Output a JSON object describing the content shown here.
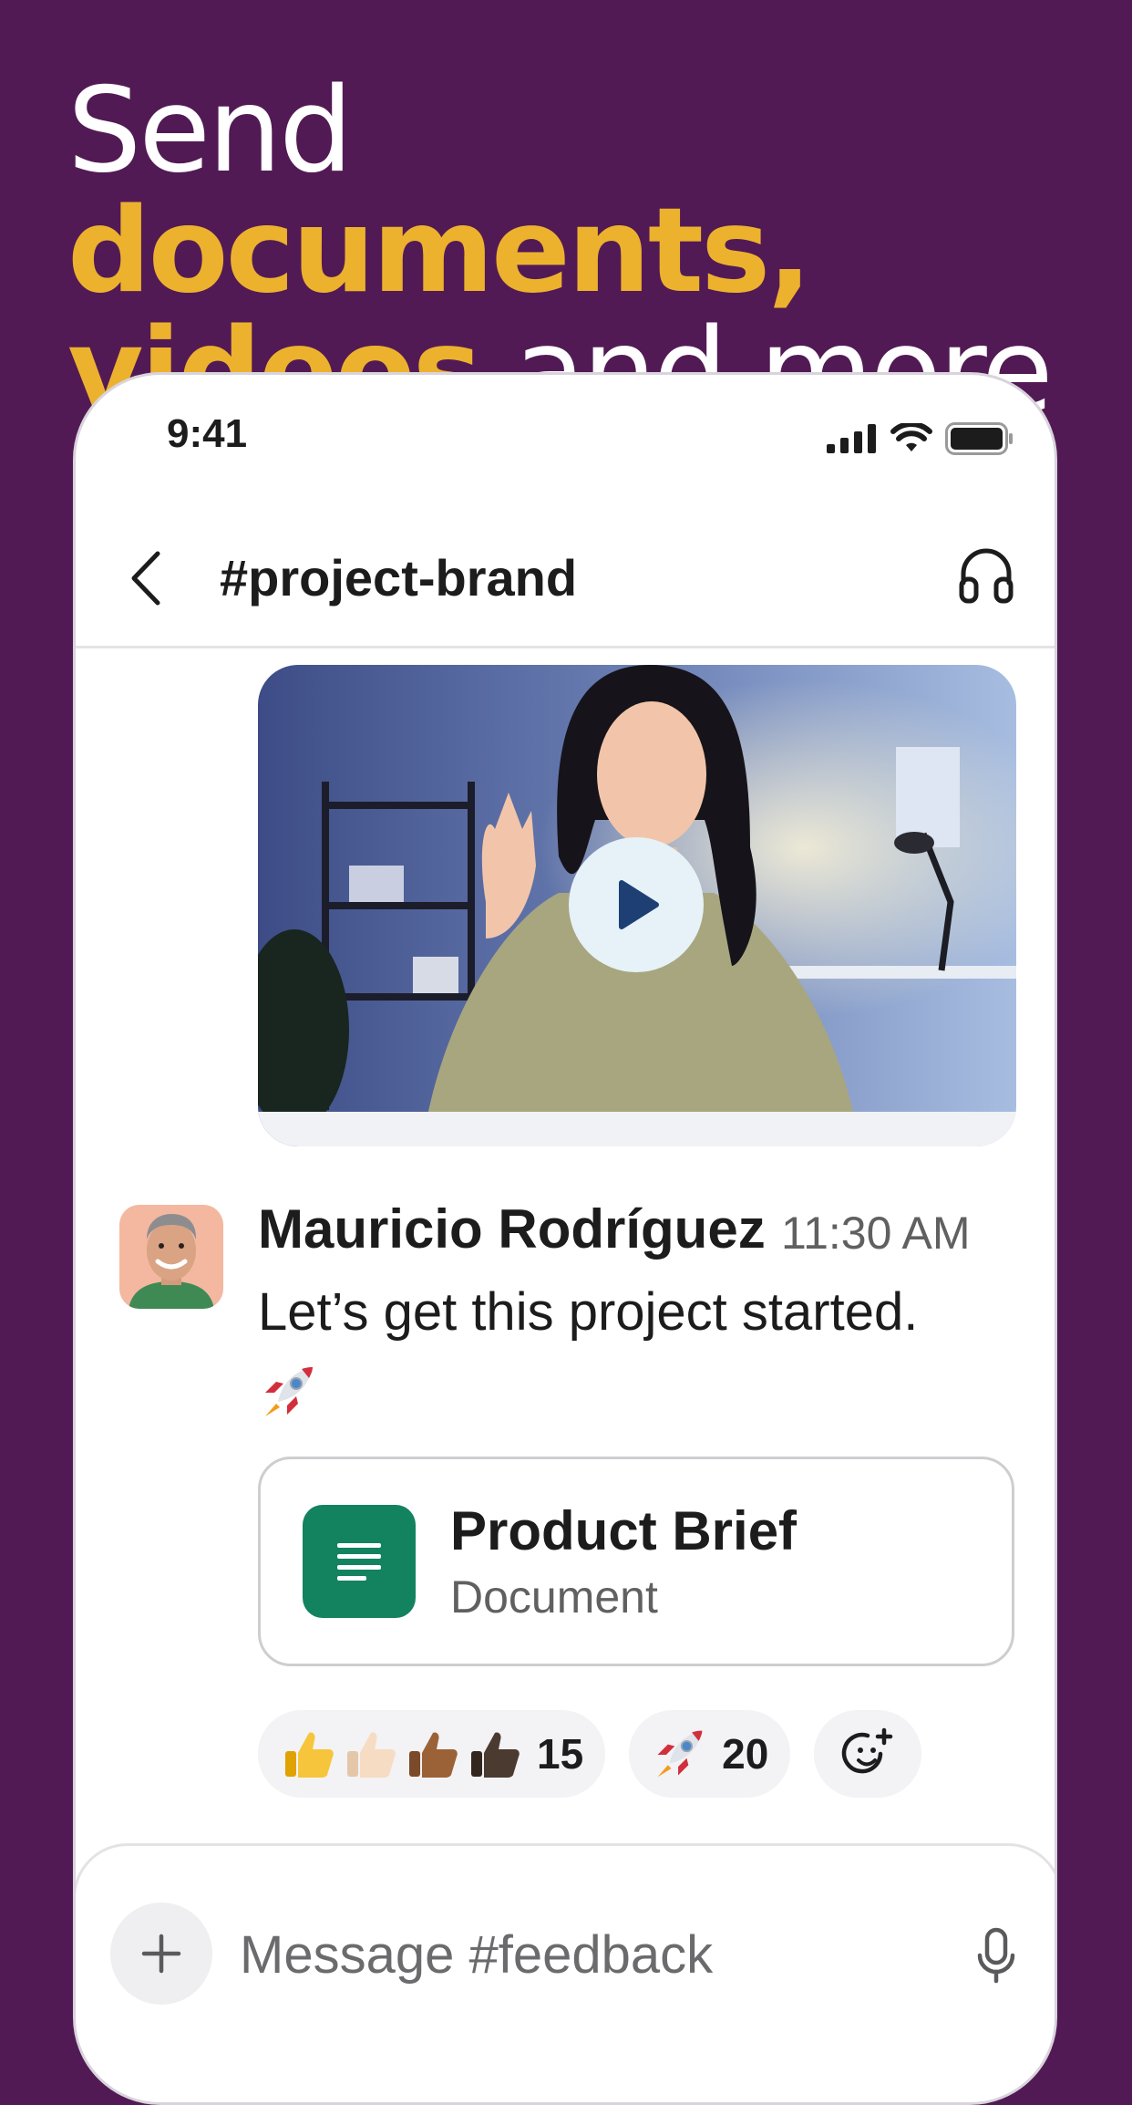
{
  "headline": {
    "word1": "Send",
    "word2": "documents,",
    "word3": "videos",
    "word4": "and more"
  },
  "status_bar": {
    "time": "9:41",
    "icons": [
      "signal-icon",
      "wifi-icon",
      "battery-icon"
    ]
  },
  "header": {
    "channel": "#project-brand",
    "back_icon": "chevron-left-icon",
    "huddle_icon": "headphones-icon"
  },
  "video": {
    "play_icon": "play-icon"
  },
  "message": {
    "sender": "Mauricio Rodríguez",
    "time": "11:30 AM",
    "text": "Let’s get this project started.",
    "emoji": "rocket"
  },
  "attachment": {
    "title": "Product Brief",
    "type": "Document",
    "icon": "document-icon"
  },
  "reactions": [
    {
      "emojis": [
        "thumbs-up",
        "thumbs-up-light",
        "thumbs-up-medium-dark",
        "thumbs-up-dark"
      ],
      "count": "15"
    },
    {
      "emojis": [
        "rocket"
      ],
      "count": "20"
    }
  ],
  "composer": {
    "placeholder": "Message #feedback",
    "plus_icon": "plus-icon",
    "mic_icon": "microphone-icon"
  },
  "colors": {
    "background": "#521A54",
    "highlight": "#ECB22E",
    "doc_green": "#12825F"
  }
}
